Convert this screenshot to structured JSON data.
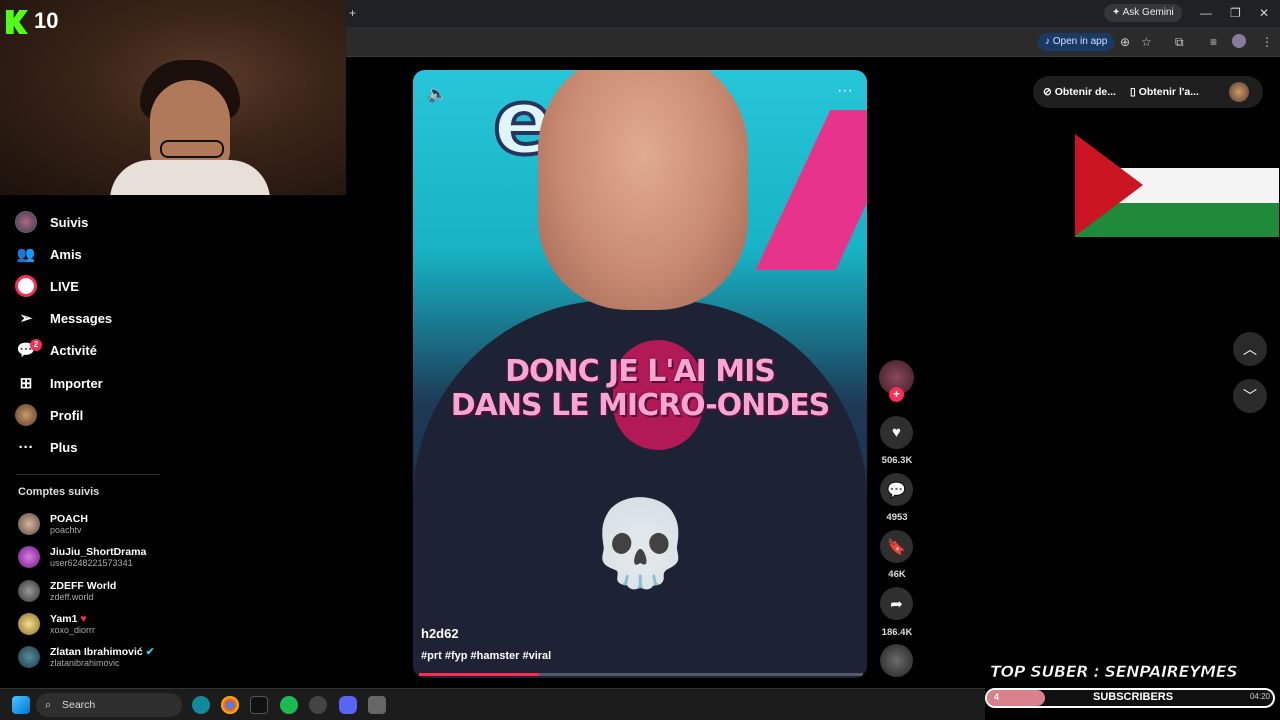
{
  "webcam": {
    "overlay_count": "10"
  },
  "browser": {
    "new_tab": "+",
    "ask_gemini": "Ask Gemini",
    "open_in_app": "Open in app",
    "window_buttons": [
      "—",
      "❐",
      "✕"
    ]
  },
  "sidebar": {
    "nav": [
      {
        "label": "Suivis",
        "icon": "following-avatar-icon"
      },
      {
        "label": "Amis",
        "icon": "friends-icon"
      },
      {
        "label": "LIVE",
        "icon": "live-icon"
      },
      {
        "label": "Messages",
        "icon": "messages-icon"
      },
      {
        "label": "Activité",
        "icon": "activity-icon"
      },
      {
        "label": "Importer",
        "icon": "upload-icon"
      },
      {
        "label": "Profil",
        "icon": "profile-avatar-icon"
      },
      {
        "label": "Plus",
        "icon": "more-icon"
      }
    ],
    "activity_badge": "2",
    "followed_title": "Comptes suivis",
    "followed": [
      {
        "name": "POACH",
        "user": "poachtv"
      },
      {
        "name": "JiuJiu_ShortDrama",
        "user": "user6248221573341"
      },
      {
        "name": "ZDEFF World",
        "user": "zdeff.world"
      },
      {
        "name": "Yam1",
        "user": "xoxo_diorrr"
      },
      {
        "name": "Zlatan Ibrahimović",
        "user": "zlatanibrahimovic"
      }
    ]
  },
  "video": {
    "caption_line1": "DONC JE L'AI MIS",
    "caption_line2": "DANS LE MICRO-ONDES",
    "author": "h2d62",
    "hashtags": "#prt #fyp #hamster #viral",
    "progress": 0.27
  },
  "actions": {
    "likes": "506.3K",
    "comments": "4953",
    "saves": "46K",
    "shares": "186.4K"
  },
  "top_bar": {
    "get_coins": "Obtenir de...",
    "get_app": "Obtenir l'a..."
  },
  "overlay": {
    "top_suber": "TOP SUBER : SENPAIREYMES",
    "subscribers_label": "SUBSCRIBERS",
    "subscribers_count": "4"
  },
  "taskbar": {
    "search_placeholder": "Search",
    "time": "04:20"
  },
  "colors": {
    "accent": "#fe2c55",
    "kick": "#53fc18"
  }
}
